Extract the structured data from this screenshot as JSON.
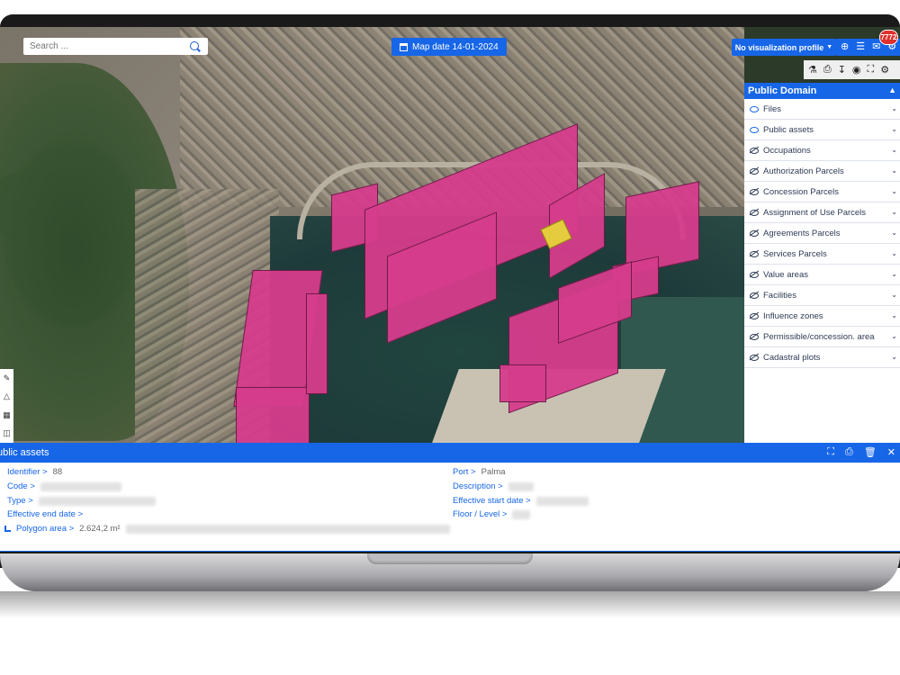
{
  "search": {
    "placeholder": "Search ..."
  },
  "map": {
    "date_label": "Map date 14-01-2024"
  },
  "toolbar": {
    "profile_label": "No visualization profile",
    "notification_count": "7772"
  },
  "panel": {
    "title": "Public Domain",
    "layers": [
      {
        "label": "Files",
        "visible": true
      },
      {
        "label": "Public assets",
        "visible": true
      },
      {
        "label": "Occupations",
        "visible": false
      },
      {
        "label": "Authorization Parcels",
        "visible": false
      },
      {
        "label": "Concession Parcels",
        "visible": false
      },
      {
        "label": "Assignment of Use Parcels",
        "visible": false
      },
      {
        "label": "Agreements Parcels",
        "visible": false
      },
      {
        "label": "Services Parcels",
        "visible": false
      },
      {
        "label": "Value areas",
        "visible": false
      },
      {
        "label": "Facilities",
        "visible": false
      },
      {
        "label": "Influence zones",
        "visible": false
      },
      {
        "label": "Permissible/concession. area",
        "visible": false
      },
      {
        "label": "Cadastral plots",
        "visible": false
      }
    ]
  },
  "details": {
    "title": "ublic assets",
    "identifier_label": "Identifier >",
    "identifier_value": "88",
    "code_label": "Code >",
    "type_label": "Type >",
    "effective_end_label": "Effective end date >",
    "polygon_area_label": "Polygon area >",
    "polygon_area_value": "2.624,2 m²",
    "port_label": "Port >",
    "port_value": "Palma",
    "description_label": "Description >",
    "effective_start_label": "Effective start date >",
    "floor_label": "Floor / Level >"
  },
  "colors": {
    "accent": "#1766e8",
    "parcel": "#d63c8c",
    "selected_parcel": "#e6d43a",
    "badge": "#e0302c"
  },
  "icons": [
    "search-icon",
    "calendar-icon",
    "plus-icon",
    "list-icon",
    "mail-icon",
    "settings-icon",
    "eye-icon",
    "fullscreen-icon",
    "chevron-down-icon"
  ]
}
